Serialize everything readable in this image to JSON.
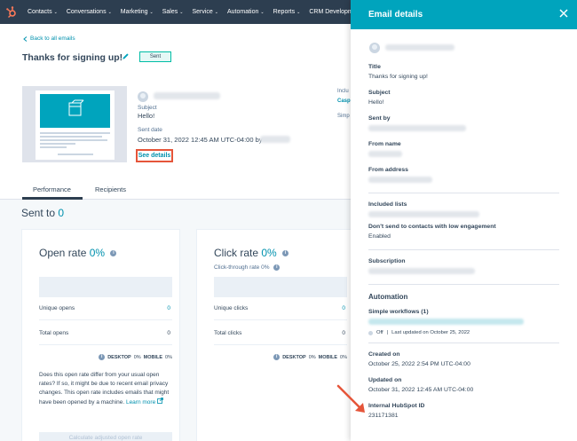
{
  "nav": {
    "items": [
      {
        "label": "Contacts",
        "caret": "⌄"
      },
      {
        "label": "Conversations",
        "caret": "⌄"
      },
      {
        "label": "Marketing",
        "caret": "⌄"
      },
      {
        "label": "Sales",
        "caret": "⌄"
      },
      {
        "label": "Service",
        "caret": "⌄"
      },
      {
        "label": "Automation",
        "caret": "⌄"
      },
      {
        "label": "Reports",
        "caret": "⌄"
      },
      {
        "label": "CRM Development",
        "caret": ""
      }
    ]
  },
  "main": {
    "back_link": "Back to all emails",
    "title": "Thanks for signing up!",
    "status_badge": "Sent",
    "subject_label": "Subject",
    "subject_value": "Hello!",
    "sent_date_label": "Sent date",
    "sent_date_value": "October 31, 2022 12:45 AM UTC-04:00 by",
    "see_details": "See details",
    "side_fragment_1": "Inclu",
    "side_fragment_2": "Casp",
    "side_fragment_3": "Simp"
  },
  "tabs": [
    {
      "label": "Performance",
      "active": true
    },
    {
      "label": "Recipients",
      "active": false
    }
  ],
  "performance": {
    "sent_to_label": "Sent to",
    "sent_to_value": "0",
    "open_card": {
      "title": "Open rate",
      "pct": "0%",
      "unique_label": "Unique opens",
      "unique_value": "0",
      "total_label": "Total opens",
      "total_value": "0",
      "desktop": "DESKTOP",
      "desktop_pct": "0%",
      "mobile": "MOBILE",
      "mobile_pct": "0%",
      "paragraph": "Does this open rate differ from your usual open rates? If so, it might be due to recent email privacy changes. This open rate includes emails that might have been opened by a machine.",
      "learn_more": "Learn more",
      "calc_button": "Calculate adjusted open rate"
    },
    "click_card": {
      "title": "Click rate",
      "pct": "0%",
      "subtitle": "Click-through rate 0%",
      "unique_label": "Unique clicks",
      "unique_value": "0",
      "total_label": "Total clicks",
      "total_value": "0",
      "desktop": "DESKTOP",
      "desktop_pct": "0%",
      "mobile": "MOBILE",
      "mobile_pct": "0%"
    }
  },
  "panel": {
    "title": "Email details",
    "title_label": "Title",
    "title_value": "Thanks for signing up!",
    "subject_label": "Subject",
    "subject_value": "Hello!",
    "sent_by_label": "Sent by",
    "from_name_label": "From name",
    "from_address_label": "From address",
    "included_lists_label": "Included lists",
    "low_engagement_label": "Don't send to contacts with low engagement",
    "low_engagement_value": "Enabled",
    "subscription_label": "Subscription",
    "automation_section": "Automation",
    "simple_workflows_label": "Simple workflows (1)",
    "workflow_status": "Off",
    "workflow_updated": "Last updated on October 25, 2022",
    "created_on_label": "Created on",
    "created_on_value": "October 25, 2022 2:54 PM UTC-04:00",
    "updated_on_label": "Updated on",
    "updated_on_value": "October 31, 2022 12:45 AM UTC-04:00",
    "hubspot_id_label": "Internal HubSpot ID",
    "hubspot_id_value": "231171381"
  },
  "colors": {
    "nav_bg": "#2d3e50",
    "accent_teal": "#00a4bd",
    "link": "#0091ae",
    "highlight": "#e5553a",
    "logo": "#ff7a59"
  }
}
